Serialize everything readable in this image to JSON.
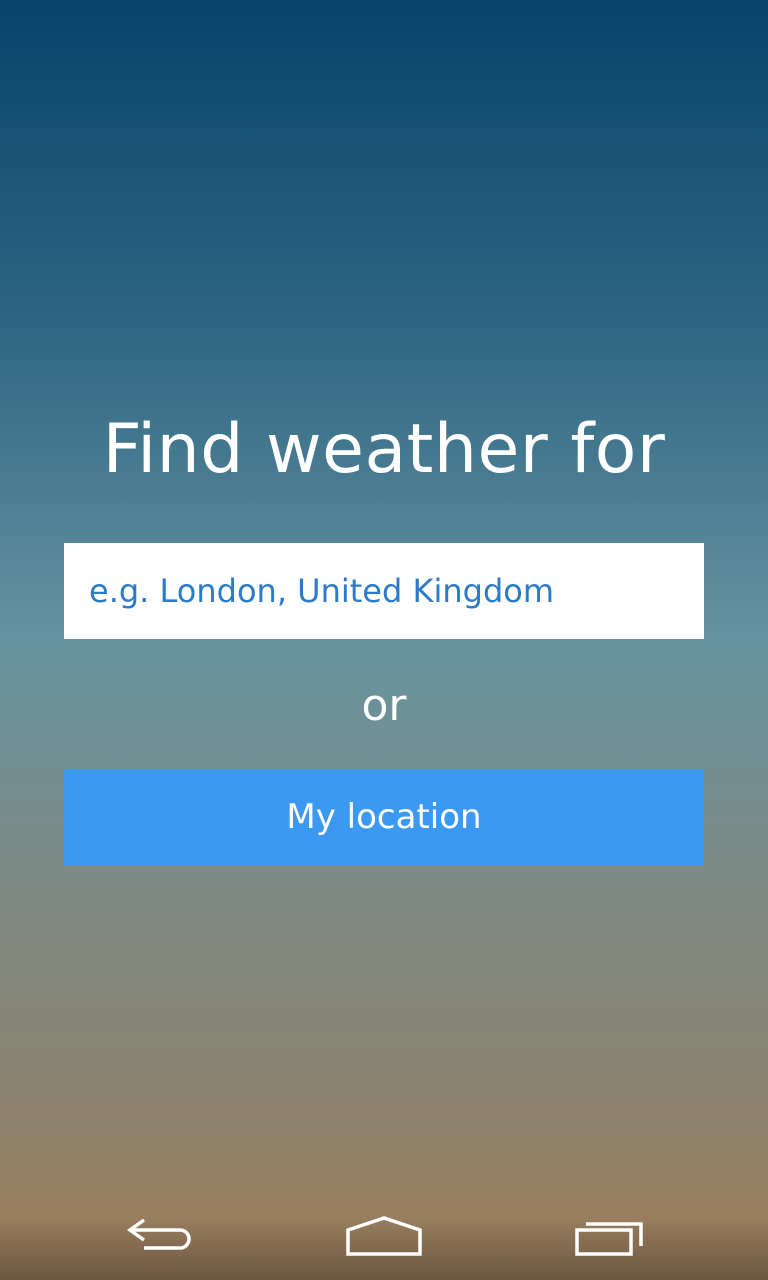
{
  "main": {
    "title": "Find weather for",
    "search": {
      "placeholder": "e.g. London, United Kingdom",
      "value": ""
    },
    "separator": "or",
    "location_button_label": "My location"
  },
  "navbar": {
    "back_icon": "back-icon",
    "home_icon": "home-icon",
    "recents_icon": "recents-icon"
  },
  "colors": {
    "gradient_top": "#06446c",
    "gradient_bottom": "#9a7f60",
    "input_text": "#2b7bc8",
    "button_bg": "#3b99f1"
  }
}
